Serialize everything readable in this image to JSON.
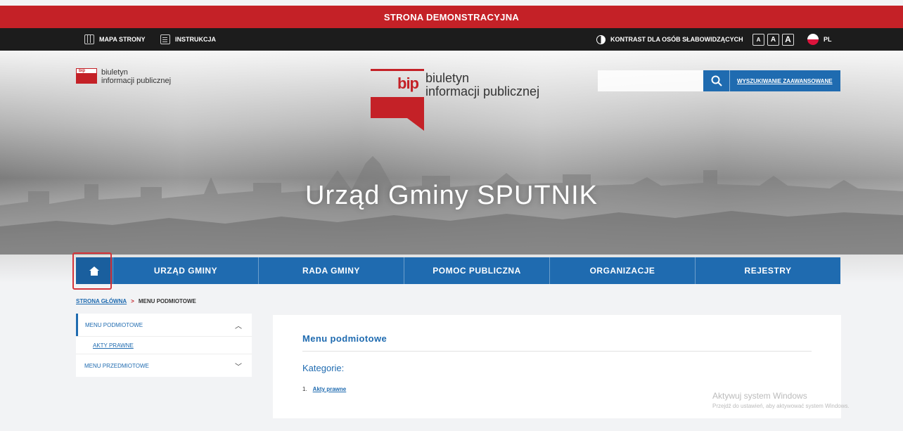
{
  "demo_banner": "STRONA DEMONSTRACYJNA",
  "top_bar": {
    "site_map": "MAPA STRONY",
    "instructions": "INSTRUKCJA",
    "contrast": "KONTRAST DLA OSÓB SŁABOWIDZĄCYCH",
    "font_sizes": [
      "A",
      "A",
      "A"
    ],
    "language": "PL"
  },
  "small_logo": {
    "badge": "bip",
    "line1": "biuletyn",
    "line2": "informacji publicznej"
  },
  "big_logo": {
    "badge": "bip",
    "line1": "biuletyn",
    "line2": "informacji publicznej"
  },
  "search": {
    "placeholder": "",
    "advanced_label": "WYSZUKIWANIE ZAAWANSOWANE"
  },
  "hero_title": "Urząd Gminy SPUTNIK",
  "nav": {
    "items": [
      "URZĄD GMINY",
      "RADA GMINY",
      "POMOC PUBLICZNA",
      "ORGANIZACJE",
      "REJESTRY"
    ]
  },
  "breadcrumb": {
    "home": "STRONA GŁÓWNA",
    "separator": ">",
    "current": "MENU PODMIOTOWE"
  },
  "side_menu": {
    "item1": "MENU PODMIOTOWE",
    "sub1": "AKTY PRAWNE",
    "item2": "MENU PRZEDMIOTOWE"
  },
  "content": {
    "title": "Menu podmiotowe",
    "subtitle": "Kategorie:",
    "list": [
      {
        "num": "1.",
        "label": "Akty prawne"
      }
    ]
  },
  "watermark": {
    "line1": "Aktywuj system Windows",
    "line2": "Przejdź do ustawień, aby aktywować system Windows."
  },
  "colors": {
    "accent": "#1f6bb0",
    "brand_red": "#c42127",
    "top_bar": "#1c1c1c"
  }
}
